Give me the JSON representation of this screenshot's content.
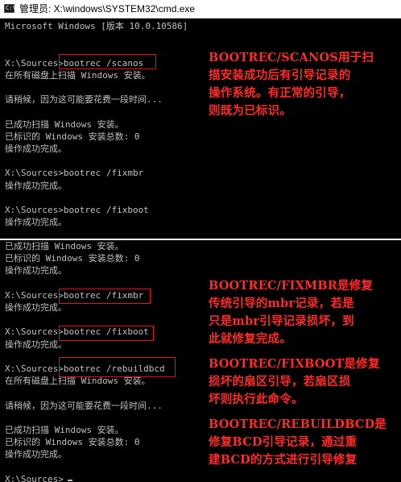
{
  "window": {
    "title": "管理员: X:\\windows\\SYSTEM32\\cmd.exe",
    "icon": "cmd-icon"
  },
  "top_console": [
    "Microsoft Windows [版本 10.0.10586]",
    "",
    "",
    "X:\\Sources>bootrec /scanos",
    "在所有磁盘上扫描 Windows 安装。",
    "",
    "请稍候，因为这可能要花费一段时间...",
    "",
    "已成功扫描 Windows 安装。",
    "已标识的 Windows 安装总数: 0",
    "操作成功完成。",
    "",
    "X:\\Sources>bootrec /fixmbr",
    "操作成功完成。",
    "",
    "X:\\Sources>bootrec /fixboot",
    "操作成功完成。"
  ],
  "bottom_console": [
    "已成功扫描 Windows 安装。",
    "已标识的 Windows 安装总数: 0",
    "操作成功完成。",
    "",
    "X:\\Sources>bootrec /fixmbr",
    "操作成功完成。",
    "",
    "X:\\Sources>bootrec /fixboot",
    "操作成功完成。",
    "",
    "X:\\Sources>bootrec /rebuildbcd",
    "在所有磁盘上扫描 Windows 安装。",
    "",
    "请稍候，因为这可能要花费一段时间...",
    "",
    "已成功扫描 Windows 安装。",
    "已标识的 Windows 安装总数: 0",
    "操作成功完成。",
    "",
    "X:\\Sources>"
  ],
  "annotations": {
    "scanos": [
      "BOOTREC/SCANOS用于扫",
      "描安装成功后有引导记录的",
      "操作系统。有正常的引导，",
      "则既为已标识。"
    ],
    "fixmbr": [
      "BOOTREC/FIXMBR是修复",
      "传统引导的mbr记录，若是",
      "只是mbr引导记录损坏，到",
      "此就修复完成。"
    ],
    "fixboot": [
      "BOOTREC/FIXBOOT是修复",
      "损坏的扇区引导，若扇区损",
      "坏则执行此命令。"
    ],
    "rebuildbcd": [
      "BOOTREC/REBUILDBCD是",
      "修复BCD引导记录，通过重",
      "建BCD的方式进行引导修复"
    ]
  },
  "colors": {
    "console_bg": "#000000",
    "console_text": "#c0c0c0",
    "annotation": "#ff2a2a",
    "highlight_box": "#e8141c"
  }
}
